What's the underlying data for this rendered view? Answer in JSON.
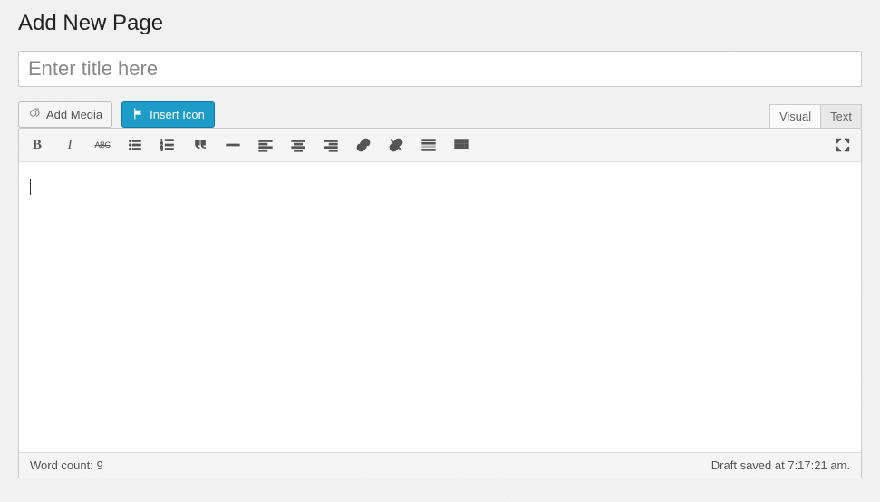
{
  "header": {
    "title": "Add New Page"
  },
  "title_field": {
    "placeholder": "Enter title here",
    "value": ""
  },
  "media_buttons": {
    "add_media": "Add Media",
    "insert_icon": "Insert Icon"
  },
  "tabs": {
    "visual": "Visual",
    "text": "Text",
    "active": "visual"
  },
  "toolbar": {
    "bold": "B",
    "italic": "I",
    "strikethrough": "ABC",
    "icons": [
      "bold-icon",
      "italic-icon",
      "strikethrough-icon",
      "bullet-list-icon",
      "numbered-list-icon",
      "blockquote-icon",
      "horizontal-rule-icon",
      "align-left-icon",
      "align-center-icon",
      "align-right-icon",
      "link-icon",
      "unlink-icon",
      "read-more-icon",
      "toolbar-toggle-icon"
    ]
  },
  "editor": {
    "content": ""
  },
  "status": {
    "word_count_label": "Word count:",
    "word_count_value": "9",
    "draft_saved": "Draft saved at 7:17:21 am."
  },
  "colors": {
    "accent": "#1e9cc8"
  }
}
